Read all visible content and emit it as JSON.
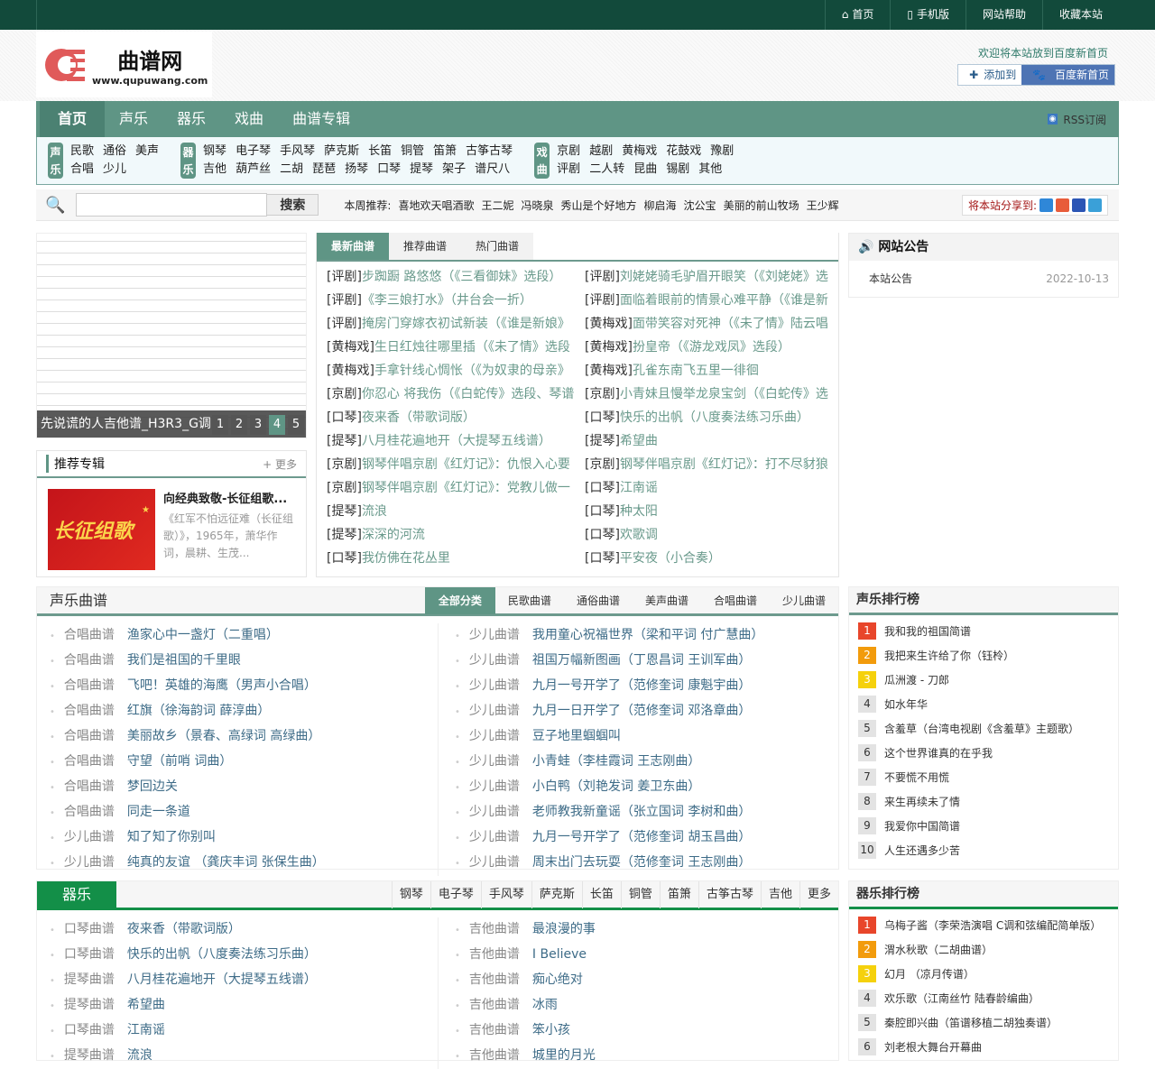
{
  "topbar": {
    "links": [
      "首页",
      "手机版",
      "网站帮助",
      "收藏本站"
    ]
  },
  "header": {
    "logo_cn": "曲谱网",
    "logo_en": "www.qupuwang.com",
    "welcome": "欢迎将本站放到百度新首页",
    "add_label": "添加到",
    "baidu_label": "百度新首页"
  },
  "nav": {
    "items": [
      "首页",
      "声乐",
      "器乐",
      "戏曲",
      "曲谱专辑"
    ],
    "rss": "RSS订阅"
  },
  "subnav": {
    "vocal": {
      "label": "声乐",
      "row1": [
        "民歌",
        "通俗",
        "美声"
      ],
      "row2": [
        "合唱",
        "少儿"
      ]
    },
    "instr": {
      "label": "器乐",
      "row1": [
        "钢琴",
        "电子琴",
        "手风琴",
        "萨克斯",
        "长笛",
        "铜管",
        "笛箫",
        "古筝古琴"
      ],
      "row2": [
        "吉他",
        "葫芦丝",
        "二胡",
        "琵琶",
        "扬琴",
        "口琴",
        "提琴",
        "架子",
        "谱尺八"
      ]
    },
    "opera": {
      "label": "戏曲",
      "row1": [
        "京剧",
        "越剧",
        "黄梅戏",
        "花鼓戏",
        "豫剧"
      ],
      "row2": [
        "评剧",
        "二人转",
        "昆曲",
        "锡剧",
        "其他"
      ]
    }
  },
  "search": {
    "button": "搜索",
    "recommend_label": "本周推荐:",
    "recommend": [
      "喜地欢天唱酒歌",
      "王二妮",
      "冯晓泉",
      "秀山是个好地方",
      "柳启海",
      "沈公宝",
      "美丽的前山牧场",
      "王少辉"
    ],
    "share_label": "将本站分享到:"
  },
  "slideshow": {
    "caption": "先说谎的人吉他谱_H3R3_G调",
    "pages": [
      "1",
      "2",
      "3",
      "4",
      "5"
    ],
    "active": "4"
  },
  "album": {
    "title": "推荐专辑",
    "more": "+ 更多",
    "name": "向经典致敬-长征组歌...",
    "desc": "《红军不怕远征难（长征组歌）》，1965年，萧华作词，晨耕、生茂...",
    "image_text": "长征组歌"
  },
  "latest": {
    "tabs": [
      "最新曲谱",
      "推荐曲谱",
      "热门曲谱"
    ],
    "items": [
      [
        "[评剧]",
        "步踟蹰 路悠悠（《三看御妹》选段）"
      ],
      [
        "[评剧]",
        "刘姥姥骑毛驴眉开眼笑（《刘姥姥》选"
      ],
      [
        "[评剧]",
        "《李三娘打水》（井台会一折）"
      ],
      [
        "[评剧]",
        "面临着眼前的情景心难平静（《谁是新"
      ],
      [
        "[评剧]",
        "掩房门穿嫁衣初试新装（《谁是新娘》"
      ],
      [
        "[黄梅戏]",
        "面带笑容对死神（《未了情》陆云唱"
      ],
      [
        "[黄梅戏]",
        "生日红烛往哪里插（《未了情》选段"
      ],
      [
        "[黄梅戏]",
        "扮皇帝（《游龙戏凤》选段）"
      ],
      [
        "[黄梅戏]",
        "手拿针线心惆怅（《为奴隶的母亲》"
      ],
      [
        "[黄梅戏]",
        "孔雀东南飞五里一徘徊"
      ],
      [
        "[京剧]",
        "你忍心 将我伤（《白蛇传》选段、琴谱"
      ],
      [
        "[京剧]",
        "小青妹且慢举龙泉宝剑（《白蛇传》选"
      ],
      [
        "[口琴]",
        "夜来香（带歌词版）"
      ],
      [
        "[口琴]",
        "快乐的出帆（八度奏法练习乐曲）"
      ],
      [
        "[提琴]",
        "八月桂花遍地开（大提琴五线谱）"
      ],
      [
        "[提琴]",
        "希望曲"
      ],
      [
        "[京剧]",
        "钢琴伴唱京剧《红灯记》：仇恨入心要"
      ],
      [
        "[京剧]",
        "钢琴伴唱京剧《红灯记》：打不尽豺狼"
      ],
      [
        "[京剧]",
        "钢琴伴唱京剧《红灯记》：党教儿做一"
      ],
      [
        "[口琴]",
        "江南谣"
      ],
      [
        "[提琴]",
        "流浪"
      ],
      [
        "[口琴]",
        "种太阳"
      ],
      [
        "[提琴]",
        "深深的河流"
      ],
      [
        "[口琴]",
        "欢歌调"
      ],
      [
        "[口琴]",
        "我仿佛在花丛里"
      ],
      [
        "[口琴]",
        "平安夜（小合奏）"
      ]
    ]
  },
  "notice": {
    "title": "网站公告",
    "item": "本站公告",
    "date": "2022-10-13"
  },
  "vocal": {
    "title": "声乐曲谱",
    "tabs": [
      "全部分类",
      "民歌曲谱",
      "通俗曲谱",
      "美声曲谱",
      "合唱曲谱",
      "少儿曲谱"
    ],
    "left": [
      [
        "合唱曲谱",
        "渔家心中一盏灯（二重唱）"
      ],
      [
        "合唱曲谱",
        "我们是祖国的千里眼"
      ],
      [
        "合唱曲谱",
        "飞吧！英雄的海鹰（男声小合唱）"
      ],
      [
        "合唱曲谱",
        "红旗（徐海韵词 薛淳曲）"
      ],
      [
        "合唱曲谱",
        "美丽故乡（景春、高绿词 高绿曲）"
      ],
      [
        "合唱曲谱",
        "守望（前哨 词曲）"
      ],
      [
        "合唱曲谱",
        "梦回边关"
      ],
      [
        "合唱曲谱",
        "同走一条道"
      ],
      [
        "少儿曲谱",
        "知了知了你别叫"
      ],
      [
        "少儿曲谱",
        "纯真的友谊 （龚庆丰词 张保生曲）"
      ]
    ],
    "right": [
      [
        "少儿曲谱",
        "我用童心祝福世界（梁和平词 付广慧曲）"
      ],
      [
        "少儿曲谱",
        "祖国万幅新图画（丁恩昌词 王训军曲）"
      ],
      [
        "少儿曲谱",
        "九月一号开学了（范修奎词 康魁宇曲）"
      ],
      [
        "少儿曲谱",
        "九月一日开学了（范修奎词 邓洛章曲）"
      ],
      [
        "少儿曲谱",
        "豆子地里蝈蝈叫"
      ],
      [
        "少儿曲谱",
        "小青蛙（李桂霞词 王志刚曲）"
      ],
      [
        "少儿曲谱",
        "小白鸭（刘艳发词 姜卫东曲）"
      ],
      [
        "少儿曲谱",
        "老师教我新童谣（张立国词 李树和曲）"
      ],
      [
        "少儿曲谱",
        "九月一号开学了（范修奎词 胡玉昌曲）"
      ],
      [
        "少儿曲谱",
        "周末出门去玩耍（范修奎词 王志刚曲）"
      ]
    ]
  },
  "vocal_rank": {
    "title": "声乐排行榜",
    "items": [
      "我和我的祖国简谱",
      "我把来生许给了你（钰柃）",
      "瓜洲渡 - 刀郎",
      "如水年华",
      "含羞草（台湾电视剧《含羞草》主题歌）",
      "这个世界谁真的在乎我",
      "不要慌不用慌",
      "来生再续未了情",
      "我爱你中国简谱",
      "人生还遇多少苦"
    ]
  },
  "instrument": {
    "title": "器乐",
    "tabs": [
      "钢琴",
      "电子琴",
      "手风琴",
      "萨克斯",
      "长笛",
      "铜管",
      "笛箫",
      "古筝古琴",
      "吉他",
      "更多"
    ],
    "left": [
      [
        "口琴曲谱",
        "夜来香（带歌词版）"
      ],
      [
        "口琴曲谱",
        "快乐的出帆（八度奏法练习乐曲）"
      ],
      [
        "提琴曲谱",
        "八月桂花遍地开（大提琴五线谱）"
      ],
      [
        "提琴曲谱",
        "希望曲"
      ],
      [
        "口琴曲谱",
        "江南谣"
      ],
      [
        "提琴曲谱",
        "流浪"
      ]
    ],
    "right": [
      [
        "吉他曲谱",
        "最浪漫的事"
      ],
      [
        "吉他曲谱",
        "I Believe"
      ],
      [
        "吉他曲谱",
        "痴心绝对"
      ],
      [
        "吉他曲谱",
        "冰雨"
      ],
      [
        "吉他曲谱",
        "笨小孩"
      ],
      [
        "吉他曲谱",
        "城里的月光"
      ]
    ]
  },
  "instr_rank": {
    "title": "器乐排行榜",
    "items": [
      "乌梅子酱（李荣浩演唱 C调和弦编配简单版）",
      "渭水秋歌（二胡曲谱）",
      "幻月 （凉月传谱）",
      "欢乐歌（江南丝竹 陆春龄编曲）",
      "秦腔即兴曲（笛谱移植二胡独奏谱）",
      "刘老根大舞台开幕曲"
    ]
  },
  "colors": {
    "rank1": "#e8462b",
    "rank2": "#f29b0c",
    "rank3": "#f5d10c",
    "accent": "#5f9585"
  }
}
